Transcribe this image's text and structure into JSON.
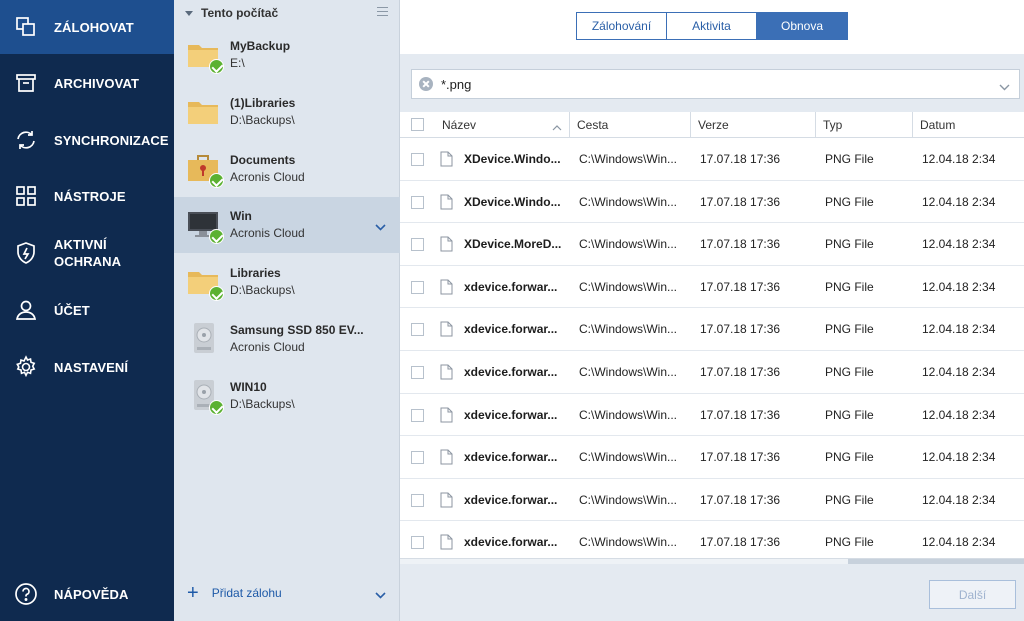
{
  "nav": {
    "items": [
      {
        "label": "ZÁLOHOVAT",
        "icon": "backup-icon"
      },
      {
        "label": "ARCHIVOVAT",
        "icon": "archive-icon"
      },
      {
        "label": "SYNCHRONIZACE",
        "icon": "sync-icon"
      },
      {
        "label": "NÁSTROJE",
        "icon": "tools-icon"
      },
      {
        "label": "AKTIVNÍ OCHRANA",
        "icon": "shield-icon"
      },
      {
        "label": "ÚČET",
        "icon": "user-icon"
      },
      {
        "label": "NASTAVENÍ",
        "icon": "gear-icon"
      }
    ],
    "help_label": "NÁPOVĚDA"
  },
  "backups": {
    "header": "Tento počítač",
    "items": [
      {
        "name": "MyBackup",
        "location": "E:\\",
        "icon": "folder-icon"
      },
      {
        "name": "(1)Libraries",
        "location": "D:\\Backups\\",
        "icon": "folder-icon"
      },
      {
        "name": "Documents",
        "location": "Acronis Cloud",
        "icon": "briefcase-icon"
      },
      {
        "name": "Win",
        "location": "Acronis Cloud",
        "icon": "monitor-icon"
      },
      {
        "name": "Libraries",
        "location": "D:\\Backups\\",
        "icon": "folder-icon"
      },
      {
        "name": "Samsung SSD 850 EV...",
        "location": "Acronis Cloud",
        "icon": "disk-icon"
      },
      {
        "name": "WIN10",
        "location": "D:\\Backups\\",
        "icon": "disk-icon"
      }
    ],
    "add_label": "Přidat zálohu"
  },
  "tabs": [
    "Zálohování",
    "Aktivita",
    "Obnova"
  ],
  "search": {
    "value": "*.png"
  },
  "table": {
    "columns": [
      "Název",
      "Cesta",
      "Verze",
      "Typ",
      "Datum"
    ],
    "rows": [
      [
        "XDevice.Windo...",
        "C:\\Windows\\Win...",
        "17.07.18 17:36",
        "PNG File",
        "12.04.18 2:34"
      ],
      [
        "XDevice.Windo...",
        "C:\\Windows\\Win...",
        "17.07.18 17:36",
        "PNG File",
        "12.04.18 2:34"
      ],
      [
        "XDevice.MoreD...",
        "C:\\Windows\\Win...",
        "17.07.18 17:36",
        "PNG File",
        "12.04.18 2:34"
      ],
      [
        "xdevice.forwar...",
        "C:\\Windows\\Win...",
        "17.07.18 17:36",
        "PNG File",
        "12.04.18 2:34"
      ],
      [
        "xdevice.forwar...",
        "C:\\Windows\\Win...",
        "17.07.18 17:36",
        "PNG File",
        "12.04.18 2:34"
      ],
      [
        "xdevice.forwar...",
        "C:\\Windows\\Win...",
        "17.07.18 17:36",
        "PNG File",
        "12.04.18 2:34"
      ],
      [
        "xdevice.forwar...",
        "C:\\Windows\\Win...",
        "17.07.18 17:36",
        "PNG File",
        "12.04.18 2:34"
      ],
      [
        "xdevice.forwar...",
        "C:\\Windows\\Win...",
        "17.07.18 17:36",
        "PNG File",
        "12.04.18 2:34"
      ],
      [
        "xdevice.forwar...",
        "C:\\Windows\\Win...",
        "17.07.18 17:36",
        "PNG File",
        "12.04.18 2:34"
      ],
      [
        "xdevice.forwar...",
        "C:\\Windows\\Win...",
        "17.07.18 17:36",
        "PNG File",
        "12.04.18 2:34"
      ]
    ]
  },
  "footer": {
    "next_label": "Další"
  },
  "colors": {
    "nav_bg": "#0f2a4f",
    "nav_active": "#1e4f8f",
    "accent": "#3b6fb6",
    "check": "#5bb131"
  }
}
